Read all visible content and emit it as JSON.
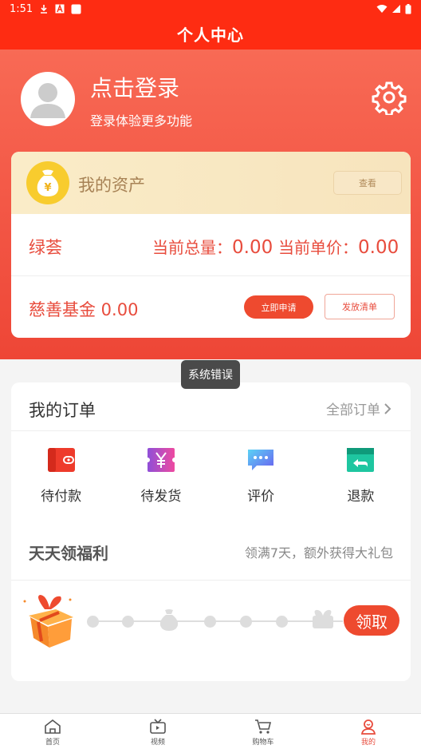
{
  "status_bar": {
    "time": "1:51"
  },
  "header": {
    "title": "个人中心"
  },
  "profile": {
    "login_title": "点击登录",
    "login_subtitle": "登录体验更多功能"
  },
  "assets": {
    "title": "我的资产",
    "view_button": "查看",
    "lvhui": {
      "label": "绿荟",
      "total_label": "当前总量：",
      "total_value": "0.00",
      "price_label": "当前单价：",
      "price_value": "0.00"
    },
    "fund": {
      "label": "慈善基金 0.00",
      "apply_button": "立即申请",
      "list_button": "发放清单"
    }
  },
  "toast": {
    "text": "系统错误"
  },
  "orders": {
    "title": "我的订单",
    "all_link": "全部订单",
    "items": [
      {
        "label": "待付款",
        "icon": "wallet-icon",
        "color": "#ee3b2b"
      },
      {
        "label": "待发货",
        "icon": "yen-icon",
        "color": "#c542c4"
      },
      {
        "label": "评价",
        "icon": "comment-icon",
        "color": "#2f9bf0"
      },
      {
        "label": "退款",
        "icon": "refund-icon",
        "color": "#1aa27a"
      }
    ]
  },
  "welfare": {
    "title": "天天领福利",
    "subtitle": "领满7天，额外获得大礼包",
    "claim_button": "领取"
  },
  "tabbar": {
    "items": [
      {
        "label": "首页",
        "icon": "home-icon",
        "active": false
      },
      {
        "label": "视频",
        "icon": "tv-icon",
        "active": false
      },
      {
        "label": "购物车",
        "icon": "cart-icon",
        "active": false
      },
      {
        "label": "我的",
        "icon": "profile-icon",
        "active": true
      }
    ]
  },
  "colors": {
    "brand_red": "#fe2c12",
    "accent": "#e84c3d",
    "gold": "#f8cc2e"
  }
}
